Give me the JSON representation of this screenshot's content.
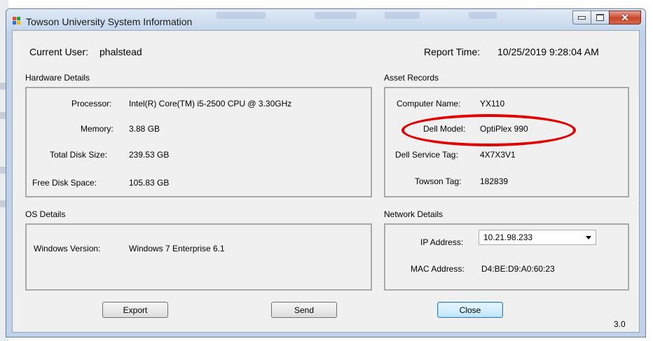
{
  "window": {
    "title": "Towson University System Information"
  },
  "header": {
    "current_user_label": "Current User:",
    "current_user_value": "phalstead",
    "report_time_label": "Report Time:",
    "report_time_value": "10/25/2019 9:28:04 AM"
  },
  "hardware": {
    "title": "Hardware Details",
    "processor_label": "Processor:",
    "processor_value": "Intel(R) Core(TM) i5-2500 CPU @ 3.30GHz",
    "memory_label": "Memory:",
    "memory_value": "3.88 GB",
    "disk_size_label": "Total Disk Size:",
    "disk_size_value": "239.53 GB",
    "free_space_label": "Free Disk Space:",
    "free_space_value": "105.83 GB"
  },
  "asset": {
    "title": "Asset Records",
    "computer_name_label": "Computer Name:",
    "computer_name_value": "YX110",
    "dell_model_label": "Dell Model:",
    "dell_model_value": "OptiPlex 990",
    "service_tag_label": "Dell Service Tag:",
    "service_tag_value": "4X7X3V1",
    "towson_tag_label": "Towson Tag:",
    "towson_tag_value": "182839"
  },
  "os": {
    "title": "OS Details",
    "version_label": "Windows Version:",
    "version_value": "Windows 7 Enterprise  6.1"
  },
  "network": {
    "title": "Network Details",
    "ip_label": "IP Address:",
    "ip_value": "10.21.98.233",
    "mac_label": "MAC Address:",
    "mac_value": "D4:BE:D9:A0:60:23"
  },
  "buttons": {
    "export": "Export",
    "send": "Send",
    "close": "Close"
  },
  "footer": {
    "version": "3.0"
  },
  "icons": {
    "app": "app-window-icon",
    "minimize": "minimize-icon",
    "maximize": "maximize-icon",
    "close": "close-icon",
    "dropdown": "chevron-down-icon"
  },
  "colors": {
    "highlight": "#e00000",
    "default_button": "#3c7fb1"
  }
}
